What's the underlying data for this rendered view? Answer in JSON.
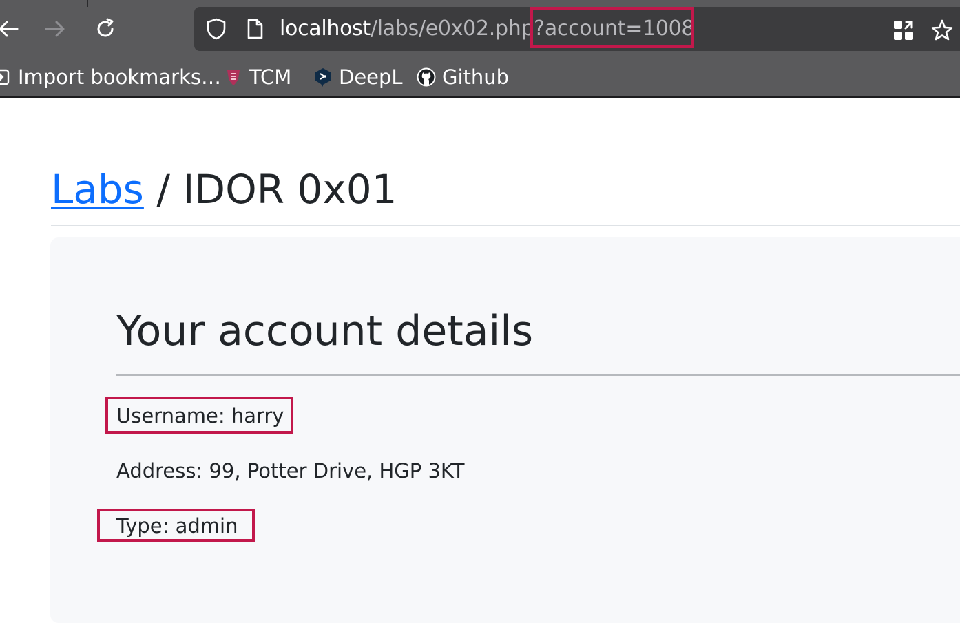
{
  "browser": {
    "url": {
      "host": "localhost",
      "path": "/labs/e0x02.php?",
      "query": "account=1008"
    },
    "icons": {
      "back": "back-arrow-icon",
      "forward": "forward-arrow-icon",
      "reload": "reload-icon",
      "shield": "shield-icon",
      "page": "page-icon",
      "extensions": "extensions-icon",
      "bookmark": "star-icon"
    }
  },
  "bookmarks": [
    {
      "label": "Import bookmarks…",
      "icon": "import-icon"
    },
    {
      "label": "TCM",
      "icon": "tcm-icon"
    },
    {
      "label": "DeepL",
      "icon": "deepl-icon"
    },
    {
      "label": "Github",
      "icon": "github-icon"
    }
  ],
  "page": {
    "breadcrumb_link": "Labs",
    "breadcrumb_separator": " / ",
    "breadcrumb_current": "IDOR 0x01",
    "card_heading": "Your account details",
    "username": "Username: harry",
    "address": "Address: 99, Potter Drive, HGP 3KT",
    "type": "Type: admin"
  },
  "colors": {
    "link": "#0d6efd",
    "highlight": "#c2184b",
    "chrome": "#5a5a5c",
    "urlbar": "#3c3c3e"
  }
}
